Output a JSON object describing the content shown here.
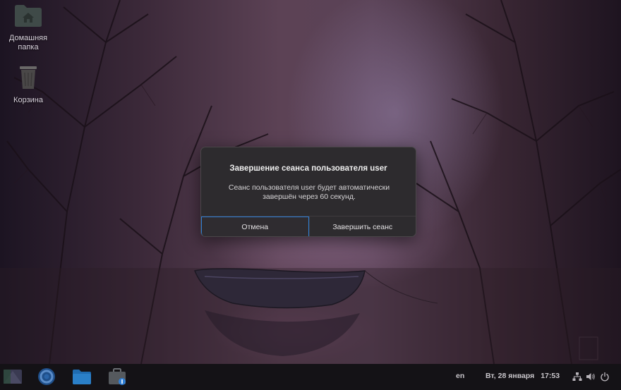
{
  "desktop": {
    "icons": [
      {
        "label": "Домашняя папка",
        "icon": "home-folder-icon"
      },
      {
        "label": "Корзина",
        "icon": "trash-icon"
      }
    ]
  },
  "dialog": {
    "title": "Завершение сеанса пользователя user",
    "message": "Сеанс пользователя user будет автоматически завершён через 60 секунд.",
    "cancel_label": "Отмена",
    "logout_label": "Завершить сеанс",
    "focus_color": "#2f7fd6"
  },
  "taskbar": {
    "apps": [
      "desktop-icon",
      "browser-icon",
      "file-manager-icon",
      "app-store-icon"
    ],
    "language": "en",
    "date": "Вт, 28 января",
    "time": "17:53",
    "tray": [
      "network-icon",
      "volume-icon",
      "power-icon"
    ]
  }
}
